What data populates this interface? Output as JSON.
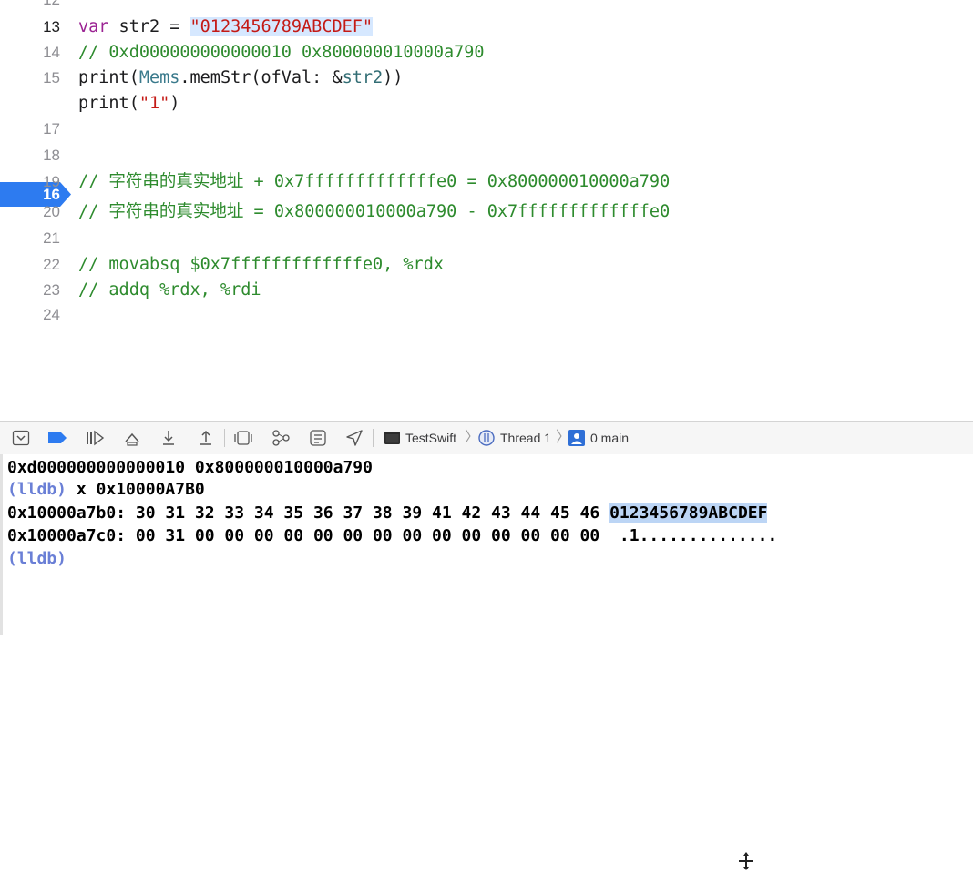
{
  "editor": {
    "lines": [
      {
        "num": "12",
        "code": ""
      },
      {
        "num": "13",
        "code": "var str2 = \"0123456789ABCDEF\""
      },
      {
        "num": "14",
        "code": "// 0xd000000000000010 0x800000010000a790"
      },
      {
        "num": "15",
        "code": "print(Mems.memStr(ofVal: &str2))"
      },
      {
        "num": "16",
        "code": "print(\"1\")"
      },
      {
        "num": "17",
        "code": ""
      },
      {
        "num": "18",
        "code": ""
      },
      {
        "num": "19",
        "code": "// 字符串的真实地址 + 0x7fffffffffffffe0 = 0x800000010000a790"
      },
      {
        "num": "20",
        "code": "// 字符串的真实地址 = 0x800000010000a790 - 0x7fffffffffffffe0"
      },
      {
        "num": "21",
        "code": ""
      },
      {
        "num": "22",
        "code": "// movabsq $0x7fffffffffffffe0, %rdx"
      },
      {
        "num": "23",
        "code": "// addq %rdx, %rdi"
      },
      {
        "num": "24",
        "code": ""
      }
    ],
    "tokens": {
      "l13_kw": "var",
      "l13_name": " str2 = ",
      "l13_str": "\"0123456789ABCDEF\"",
      "l15_print": "print(",
      "l15_cls": "Mems",
      "l15_mid": ".memStr(ofVal: &",
      "l15_var": "str2",
      "l15_end": "))",
      "l16_print": "print(",
      "l16_str": "\"1\"",
      "l16_end": ")"
    },
    "breakpoint_line": "16",
    "current_line": "13"
  },
  "debug_bar": {
    "icons": [
      "hide-console-icon",
      "breakpoint-toggle-icon",
      "continue-icon",
      "step-over-icon",
      "step-into-icon",
      "step-out-icon",
      "view-hierarchy-icon",
      "memory-graph-icon",
      "environment-overrides-icon",
      "simulate-location-icon"
    ],
    "scheme": "TestSwift",
    "thread": "Thread 1",
    "frame": "0 main"
  },
  "console": {
    "lines": [
      "0xd000000000000010 0x800000010000a790",
      "x 0x10000A7B0",
      "0x10000a7b0: 30 31 32 33 34 35 36 37 38 39 41 42 43 44 45 46 ",
      "0123456789ABCDEF",
      "0x10000a7c0: 00 31 00 00 00 00 00 00 00 00 00 00 00 00 00 00  .1.............."
    ],
    "prompt": "(lldb)"
  },
  "colors": {
    "comment": "#2e8b2e",
    "keyword": "#9b2393",
    "string": "#c41a16",
    "breakpoint": "#2d7bf0",
    "lldb_prompt": "#6a7fd6"
  }
}
